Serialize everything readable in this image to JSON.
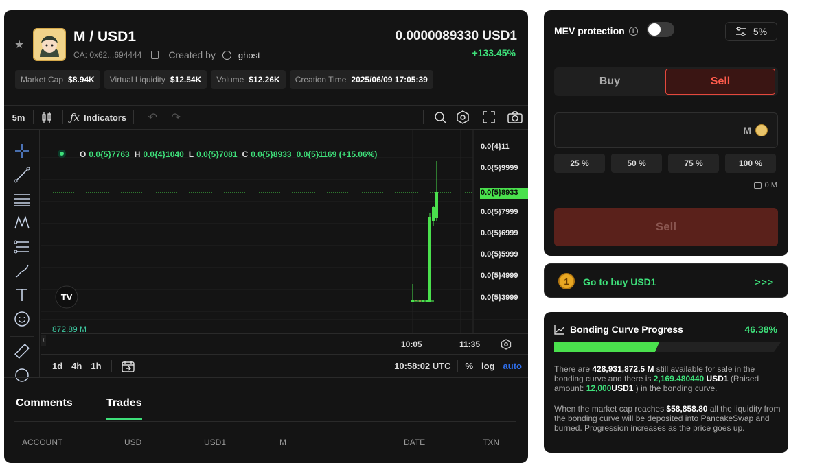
{
  "token": {
    "pair": "M / USD1",
    "ca": "CA: 0x62...694444",
    "created_by_label": "Created by",
    "creator": "ghost",
    "price": "0.0000089330 USD1",
    "change": "+133.45%"
  },
  "stats": [
    {
      "label": "Market Cap",
      "value": "$8.94K"
    },
    {
      "label": "Virtual Liquidity",
      "value": "$12.54K"
    },
    {
      "label": "Volume",
      "value": "$12.26K"
    },
    {
      "label": "Creation Time",
      "value": "2025/06/09 17:05:39"
    }
  ],
  "toolbar": {
    "interval": "5m",
    "indicators": "Indicators"
  },
  "ohlc": {
    "o_label": "O",
    "o": "0.0{5}7763",
    "h_label": "H",
    "h": "0.0{4}1040",
    "l_label": "L",
    "l": "0.0{5}7081",
    "c_label": "C",
    "c": "0.0{5}8933",
    "delta": "0.0{5}1169 (+15.06%)"
  },
  "price_axis": [
    "0.0{4}11",
    "0.0{5}9999",
    "0.0{5}7999",
    "0.0{5}6999",
    "0.0{5}5999",
    "0.0{5}4999",
    "0.0{5}3999"
  ],
  "current_price_label": "0.0{5}8933",
  "volume_label": "872.89 M",
  "time_axis": [
    "10:05",
    "11:35"
  ],
  "bottom": {
    "ranges": [
      "1d",
      "4h",
      "1h"
    ],
    "clock": "10:58:02 UTC",
    "pct": "%",
    "log": "log",
    "auto": "auto"
  },
  "tabs": {
    "comments": "Comments",
    "trades": "Trades"
  },
  "columns": [
    "ACCOUNT",
    "USD",
    "USD1",
    "M",
    "DATE",
    "TXN"
  ],
  "trade": {
    "mev_label": "MEV protection",
    "slippage": "5%",
    "buy": "Buy",
    "sell": "Sell",
    "token_symbol": "M",
    "percents": [
      "25 %",
      "50 %",
      "75 %",
      "100 %"
    ],
    "balance": "0 M",
    "submit": "Sell"
  },
  "goto": {
    "label": "Go to buy USD1",
    "arrow": ">>>",
    "icon_text": "1"
  },
  "curve": {
    "title": "Bonding Curve Progress",
    "percent": "46.38%",
    "progress": 0.4638,
    "p1_a": "There are ",
    "p1_amount": "428,931,872.5",
    "p1_unit": " M",
    "p1_b": " still available for sale in the bonding curve and there is ",
    "p1_usd": "2,169.480440",
    "p1_usd_unit": " USD1",
    "p1_c": " (Raised amount: ",
    "p1_raised": "12,000",
    "p1_raised_unit": "USD1",
    "p1_d": " ) in the bonding curve.",
    "p2_a": "When the market cap reaches ",
    "p2_cap": "$58,858.80",
    "p2_b": " all the liquidity from the bonding curve will be deposited into PancakeSwap and burned. Progression increases as the price goes up."
  },
  "colors": {
    "green": "#3ee07a",
    "red": "#e4483d",
    "candle_green": "#4ae04d",
    "blue_accent": "#2f6fed"
  }
}
